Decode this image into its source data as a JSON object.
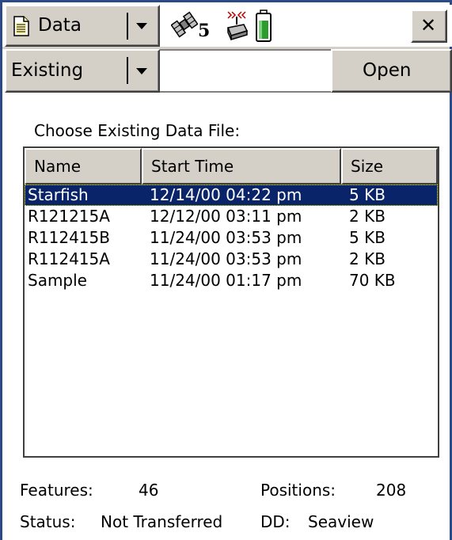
{
  "toolbar": {
    "menu_label": "Data",
    "menu_icon": "document-icon",
    "satellite_count": "5",
    "satellite_icon": "satellite-icon",
    "signal_icon": "gps-receiver-signal-icon",
    "battery_icon": "battery-icon",
    "close_label": "✕"
  },
  "action_bar": {
    "mode_selected": "Existing",
    "input_value": "",
    "open_label": "Open"
  },
  "prompt": "Choose Existing Data File:",
  "file_list": {
    "columns": [
      "Name",
      "Start Time",
      "Size"
    ],
    "rows": [
      {
        "name": "Starfish",
        "start_time": "12/14/00 04:22 pm",
        "size": "5 KB",
        "selected": true
      },
      {
        "name": "R121215A",
        "start_time": "12/12/00 03:11 pm",
        "size": "2 KB",
        "selected": false
      },
      {
        "name": "R112415B",
        "start_time": "11/24/00 03:53 pm",
        "size": "5 KB",
        "selected": false
      },
      {
        "name": "R112415A",
        "start_time": "11/24/00 03:53 pm",
        "size": "2 KB",
        "selected": false
      },
      {
        "name": "Sample",
        "start_time": "11/24/00 01:17 pm",
        "size": "70 KB",
        "selected": false
      }
    ]
  },
  "info": {
    "features_label": "Features:",
    "features_value": "46",
    "positions_label": "Positions:",
    "positions_value": "208",
    "status_label": "Status:",
    "status_value": "Not Transferred",
    "dd_label": "DD:",
    "dd_value": "Seaview"
  },
  "colors": {
    "frame": "#2b4a88",
    "button_face": "#d4d0c8",
    "selection": "#0a246a"
  }
}
